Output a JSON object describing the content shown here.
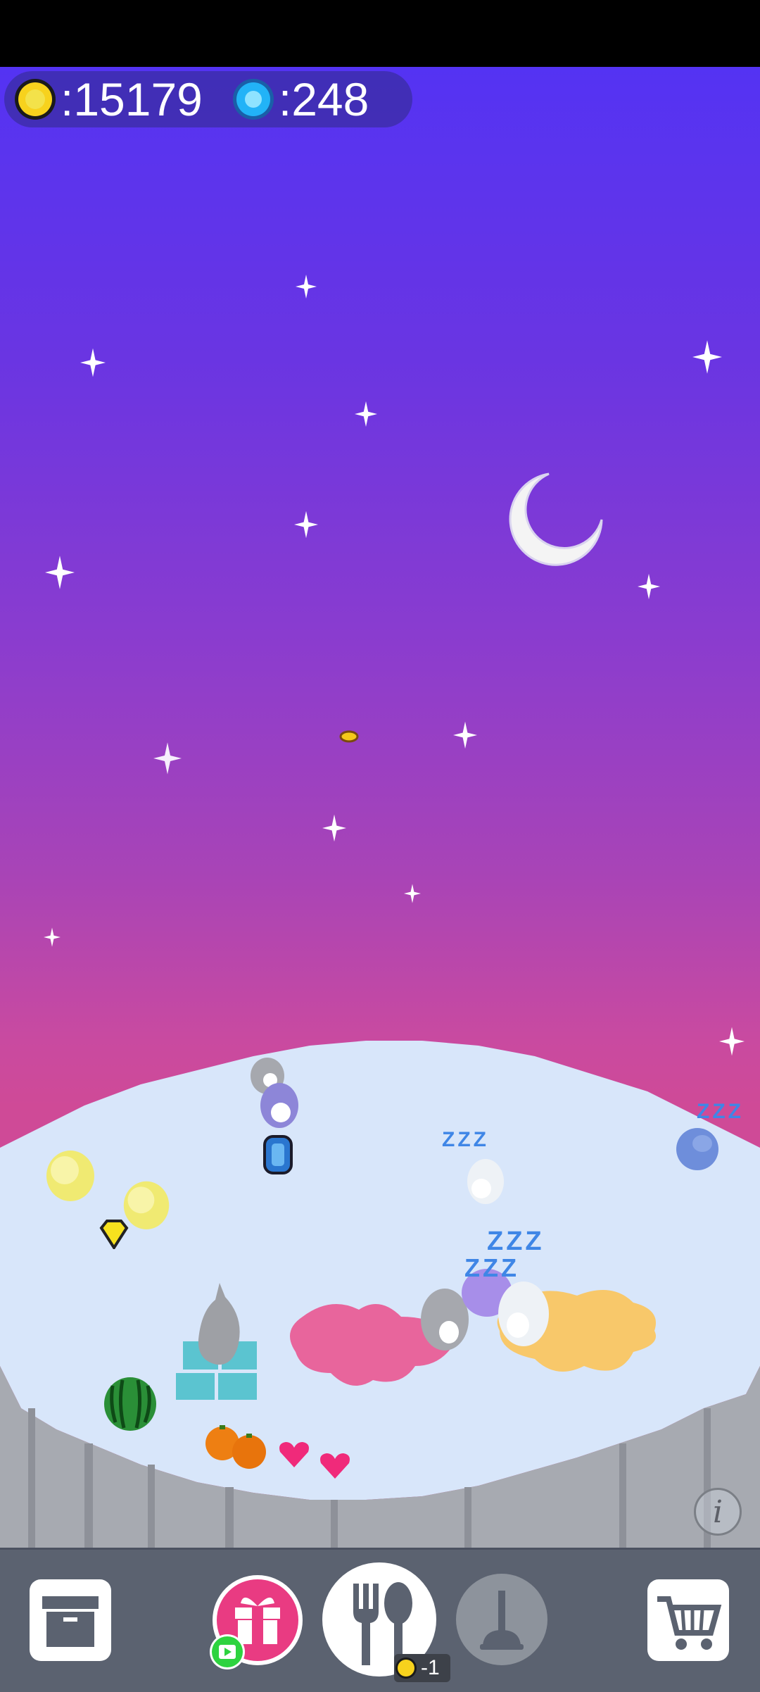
{
  "hud": {
    "coins_label": ":15179",
    "gems_label": ":248",
    "coin_icon": "gold-coin-icon",
    "gem_icon": "blue-gem-icon"
  },
  "scene": {
    "sleep_labels": [
      "ZZZ",
      "ZZZ",
      "ZZZ",
      "ZZZ"
    ],
    "colors": {
      "sky_top": "#5433f3",
      "sky_bottom": "#cf4a97",
      "ground": "#d8e6fa",
      "cliff": "#a7aab1",
      "pink_blob": "#e8659c",
      "orange_blob": "#f8c86a"
    }
  },
  "toolbar": {
    "buttons": [
      {
        "name": "archive-button",
        "icon": "archive-box-icon"
      },
      {
        "name": "gift-button",
        "icon": "gift-icon"
      },
      {
        "name": "feed-button",
        "icon": "fork-spoon-icon"
      },
      {
        "name": "clean-button",
        "icon": "plunger-icon"
      },
      {
        "name": "shop-button",
        "icon": "shopping-cart-icon"
      }
    ],
    "feed_cost": "-1",
    "info_icon": "info-icon"
  }
}
